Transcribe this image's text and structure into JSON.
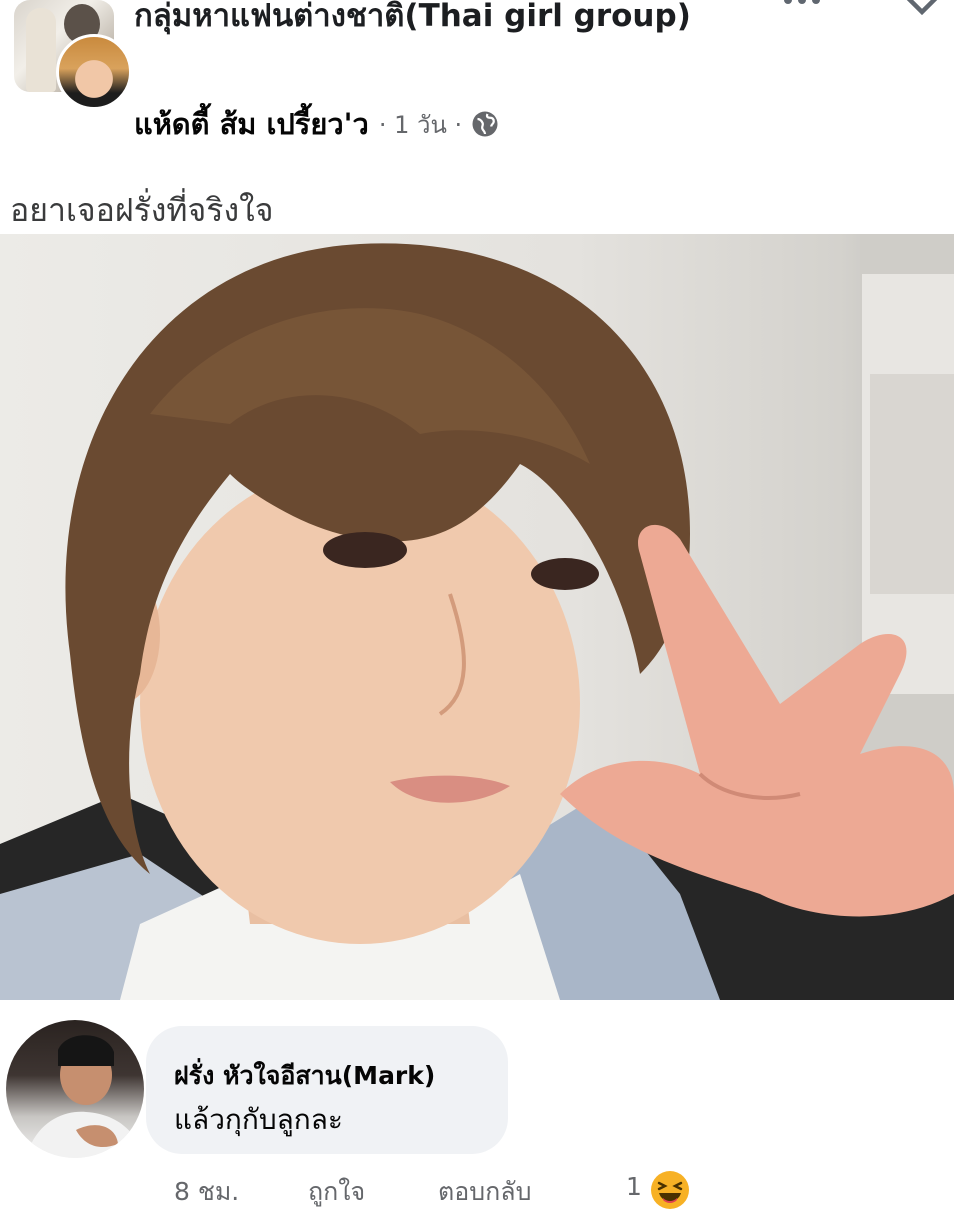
{
  "post": {
    "group_name": "กลุ่มหาแฟนต่างชาติ(Thai girl group)",
    "author": "แห้ดตี้ ส้ม เปรี้ยว'ว",
    "time": "· 1 วัน ·",
    "privacy_icon": "globe-icon",
    "text": "อยาเจอฝรั่งที่จริงใจ"
  },
  "comment": {
    "author": "ฝรั่ง หัวใจอีสาน(Mark)",
    "text": "แล้วกุกับลูกละ",
    "time": "8 ชม.",
    "like_label": "ถูกใจ",
    "reply_label": "ตอบกลับ",
    "reaction_count": "1",
    "reaction_icon": "laughing-emoji-icon"
  },
  "colors": {
    "text_primary": "#050505",
    "text_secondary": "#65676b",
    "bubble_bg": "#f0f2f5",
    "reaction_yellow": "#f7b125"
  }
}
